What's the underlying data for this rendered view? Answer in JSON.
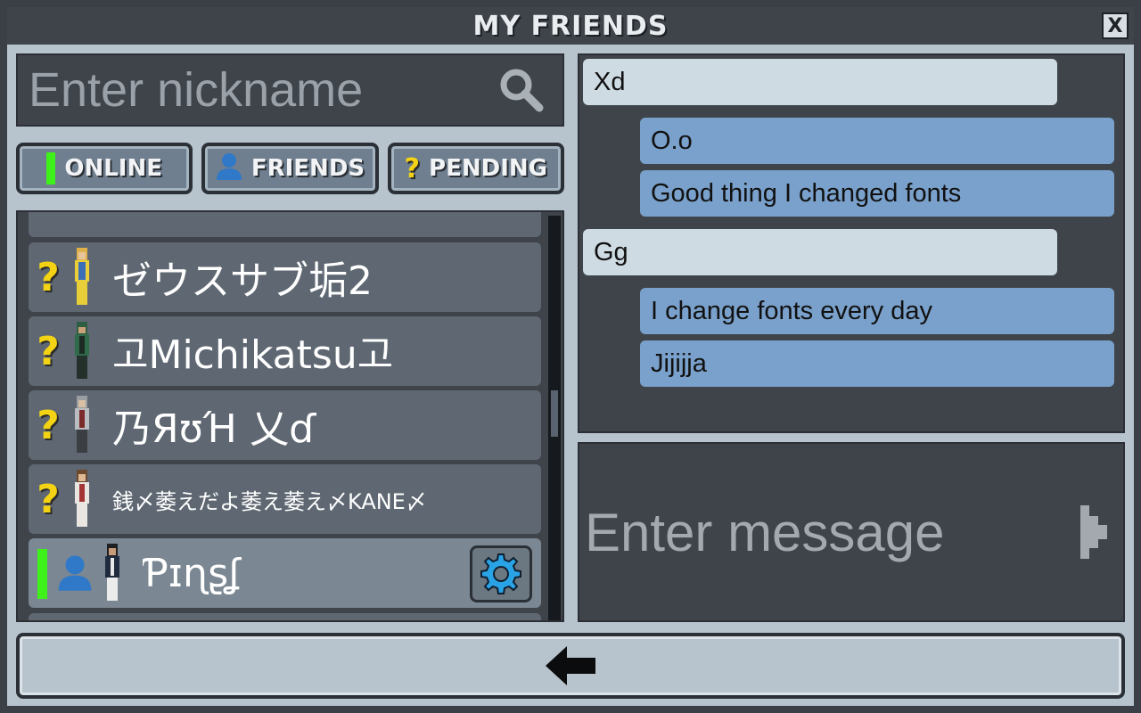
{
  "window": {
    "title": "MY FRIENDS",
    "close_label": "X"
  },
  "search": {
    "placeholder": "Enter nickname",
    "icon": "search-icon"
  },
  "tabs": [
    {
      "label": "ONLINE",
      "icon": "online-indicator",
      "color": "#3ff11b"
    },
    {
      "label": "FRIENDS",
      "icon": "friend-icon",
      "color": "#2f79c8"
    },
    {
      "label": "PENDING",
      "icon": "question-icon",
      "color": "#f3d313"
    }
  ],
  "friends": [
    {
      "status": "?",
      "name": "ゼウスサブ垢2",
      "state": "pending"
    },
    {
      "status": "?",
      "name": "고Michikatsu고",
      "state": "pending"
    },
    {
      "status": "?",
      "name": "乃ЯʊΉ 乂ɗ",
      "state": "pending"
    },
    {
      "status": "?",
      "name": "銭〆萎えだよ萎え萎え〆KANE〆",
      "state": "pending"
    },
    {
      "status": "",
      "name": "Ƥɪɳʂʆ",
      "state": "friend-online",
      "settings_icon": "gear-icon"
    }
  ],
  "messages": [
    {
      "text": "Xd",
      "side": "in"
    },
    {
      "text": "O.o",
      "side": "out"
    },
    {
      "text": "Good thing I changed fonts",
      "side": "out"
    },
    {
      "text": "Gg",
      "side": "in"
    },
    {
      "text": "I change fonts every day",
      "side": "out"
    },
    {
      "text": "Jijijja",
      "side": "out"
    }
  ],
  "compose": {
    "placeholder": "Enter message",
    "send_icon": "send-icon"
  },
  "back": {
    "icon": "back-arrow-icon"
  }
}
